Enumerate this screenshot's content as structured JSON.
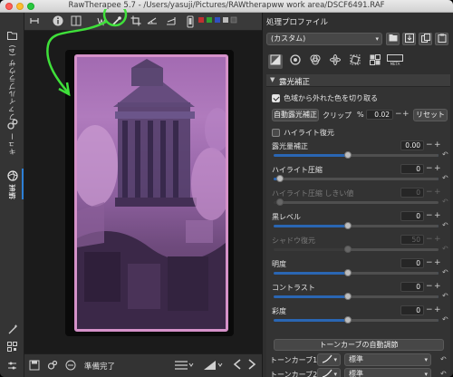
{
  "window": {
    "title": "RawTherapee 5.7 - /Users/yasuji/Pictures/RAWtherapww work area/DSCF6491.RAF"
  },
  "left_tabs": {
    "file_browser": "ファイルブラウザ (4)",
    "queue": "キュー",
    "editor": "編集"
  },
  "image_status": {
    "text": "準備完了"
  },
  "panel": {
    "header": "処理プロファイル",
    "profile_value": "(カスタム)",
    "section_title": "露光補正",
    "clip_oog_label": "色域から外れた色を切り取る",
    "auto_levels_label": "自動露光補正",
    "clip_label": "クリップ",
    "clip_percent": "%",
    "clip_value": "0.02",
    "reset_label": "リセット",
    "highlight_recovery_label": "ハイライト復元",
    "auto_tone_curve_button": "トーンカーブの自動調節",
    "controls": [
      {
        "label": "露光量補正",
        "value": "0.00",
        "dim": false
      },
      {
        "label": "ハイライト圧縮",
        "value": "0",
        "dim": false
      },
      {
        "label": "ハイライト圧縮 しきい値",
        "value": "0",
        "dim": true
      },
      {
        "label": "黒レベル",
        "value": "0",
        "dim": false
      },
      {
        "label": "シャドウ復元",
        "value": "50",
        "dim": true
      },
      {
        "label": "明度",
        "value": "0",
        "dim": false
      },
      {
        "label": "コントラスト",
        "value": "0",
        "dim": false
      },
      {
        "label": "彩度",
        "value": "0",
        "dim": false
      }
    ],
    "tone_curves": [
      {
        "label": "トーンカーブ1:",
        "mode": "標準"
      },
      {
        "label": "トーンカーブ2:",
        "mode": "標準"
      }
    ]
  },
  "colors": {
    "photo_tint": "#a36bb2",
    "border_pink": "#d591c9",
    "slider_blue": "#2a66b3",
    "annotation_green": "#3fe03a"
  }
}
